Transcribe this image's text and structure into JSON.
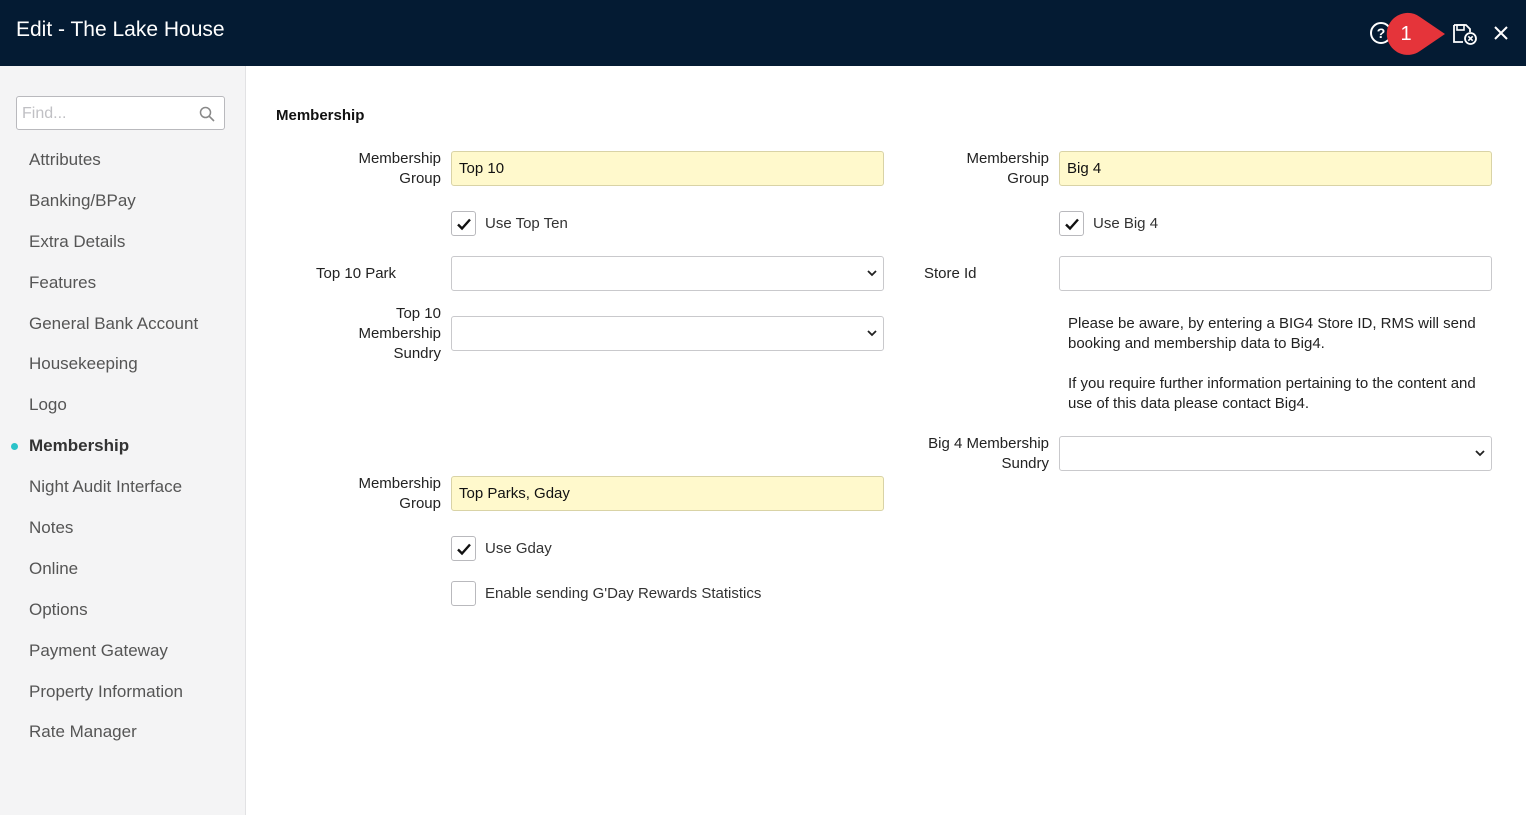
{
  "window": {
    "title": "Edit - The Lake House",
    "marker_number": "1"
  },
  "sidebar": {
    "find_placeholder": "Find...",
    "items": [
      {
        "label": "Attributes"
      },
      {
        "label": "Banking/BPay"
      },
      {
        "label": "Extra Details"
      },
      {
        "label": "Features"
      },
      {
        "label": "General Bank Account"
      },
      {
        "label": "Housekeeping"
      },
      {
        "label": "Logo"
      },
      {
        "label": "Membership"
      },
      {
        "label": "Night Audit Interface"
      },
      {
        "label": "Notes"
      },
      {
        "label": "Online"
      },
      {
        "label": "Options"
      },
      {
        "label": "Payment Gateway"
      },
      {
        "label": "Property Information"
      },
      {
        "label": "Rate Manager"
      }
    ],
    "active_item": "Membership"
  },
  "main": {
    "section_title": "Membership",
    "top10": {
      "group_label_1": "Membership",
      "group_label_2": "Group",
      "group_value": "Top 10",
      "use_label": "Use Top Ten",
      "use_checked": true,
      "park_label": "Top 10 Park",
      "park_value": "",
      "sundry_label_1": "Top 10",
      "sundry_label_2": "Membership",
      "sundry_label_3": "Sundry",
      "sundry_value": ""
    },
    "big4": {
      "group_label_1": "Membership",
      "group_label_2": "Group",
      "group_value": "Big 4",
      "use_label": "Use Big 4",
      "use_checked": true,
      "store_label": "Store Id",
      "store_value": "",
      "notice_1a": "Please be aware, by entering a BIG4 Store ID, RMS will send",
      "notice_1b": "booking and membership data to Big4.",
      "notice_2a": "If you require further information pertaining to the content and",
      "notice_2b": "use of this data please contact Big4.",
      "sundry_label_1": "Big 4 Membership",
      "sundry_label_2": "Sundry",
      "sundry_value": ""
    },
    "gday": {
      "group_label_1": "Membership",
      "group_label_2": "Group",
      "group_value": "Top Parks, Gday",
      "use_label": "Use Gday",
      "use_checked": true,
      "stats_label": "Enable sending G'Day Rewards Statistics",
      "stats_checked": false
    }
  },
  "colors": {
    "header_bg": "#041b33",
    "highlight_field": "#fff9cc",
    "active_dot": "#2ac3c9",
    "marker": "#e5343a"
  }
}
